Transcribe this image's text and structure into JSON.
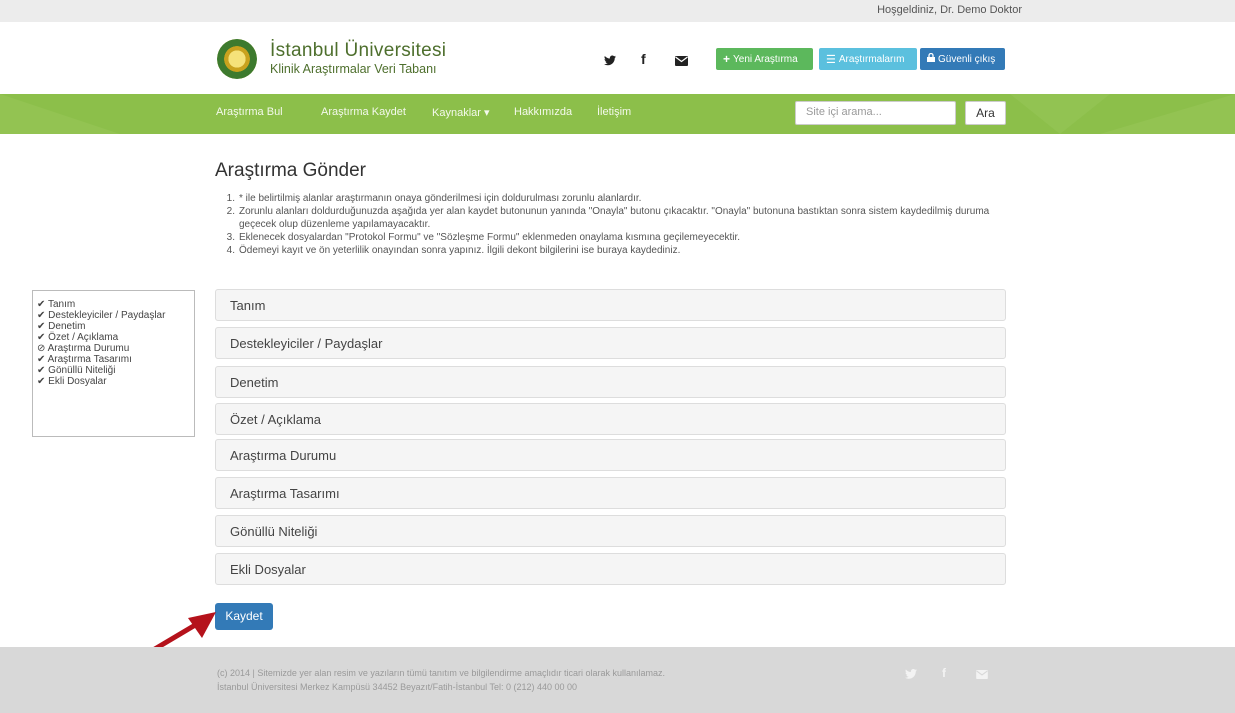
{
  "topbar": {
    "welcome": "Hoşgeldiniz, Dr. Demo Doktor"
  },
  "header": {
    "title": "İstanbul Üniversitesi",
    "subtitle": "Klinik Araştırmalar Veri Tabanı",
    "social": {
      "twitter": "🐦",
      "facebook": "f",
      "mail": "✉"
    },
    "buttons": {
      "new_research": "Yeni Araştırma",
      "my_research": "Araştırmalarım",
      "logout": "Güvenli çıkış"
    }
  },
  "nav": {
    "items": [
      "Araştırma Bul",
      "Araştırma Kaydet",
      "Kaynaklar ▾",
      "Hakkımızda",
      "İletişim"
    ],
    "search_placeholder": "Site içi arama...",
    "search_button": "Ara"
  },
  "main": {
    "title": "Araştırma Gönder",
    "instructions": [
      "* ile belirtilmiş alanlar araştırmanın onaya gönderilmesi için doldurulması zorunlu alanlardır.",
      "Zorunlu alanları doldurduğunuzda aşağıda yer alan kaydet butonunun yanında \"Onayla\" butonu çıkacaktır. \"Onayla\" butonuna bastıktan sonra sistem kaydedilmiş duruma geçecek olup düzenleme yapılamayacaktır.",
      "Eklenecek dosyalardan \"Protokol Formu\" ve \"Sözleşme Formu\" eklenmeden onaylama kısmına geçilemeyecektir.",
      "Ödemeyi kayıt ve ön yeterlilik onayından sonra yapınız. İlgili dekont bilgilerini ise buraya kaydediniz."
    ],
    "panels": [
      "Tanım",
      "Destekleyiciler / Paydaşlar",
      "Denetim",
      "Özet / Açıklama",
      "Araştırma Durumu",
      "Araştırma Tasarımı",
      "Gönüllü Niteliği",
      "Ekli Dosyalar"
    ],
    "save_button": "Kaydet"
  },
  "sidenav": {
    "items": [
      {
        "icon": "✔",
        "label": "Tanım",
        "status": "complete"
      },
      {
        "icon": "✔",
        "label": "Destekleyiciler / Paydaşlar",
        "status": "complete"
      },
      {
        "icon": "✔",
        "label": "Denetim",
        "status": "complete"
      },
      {
        "icon": "✔",
        "label": "Özet / Açıklama",
        "status": "complete"
      },
      {
        "icon": "⊘",
        "label": "Araştırma Durumu",
        "status": "incomplete"
      },
      {
        "icon": "✔",
        "label": "Araştırma Tasarımı",
        "status": "complete"
      },
      {
        "icon": "✔",
        "label": "Gönüllü Niteliği",
        "status": "complete"
      },
      {
        "icon": "✔",
        "label": "Ekli Dosyalar",
        "status": "complete"
      }
    ]
  },
  "footer": {
    "line1": "(c) 2014 | Sitemizde yer alan resim ve yazıların tümü tanıtım ve bilgilendirme amaçlıdır ticari olarak kullanılamaz.",
    "line2": "İstanbul Üniversitesi Merkez Kampüsü 34452 Beyazıt/Fatih-İstanbul Tel: 0 (212) 440 00 00"
  },
  "colors": {
    "nav_green": "#8cbf4a",
    "brand_green": "#4e6f2d",
    "primary_blue": "#337ab7",
    "success_green": "#5cb85c",
    "info_cyan": "#5bc0de",
    "annotation_arrow": "#b5121b"
  }
}
